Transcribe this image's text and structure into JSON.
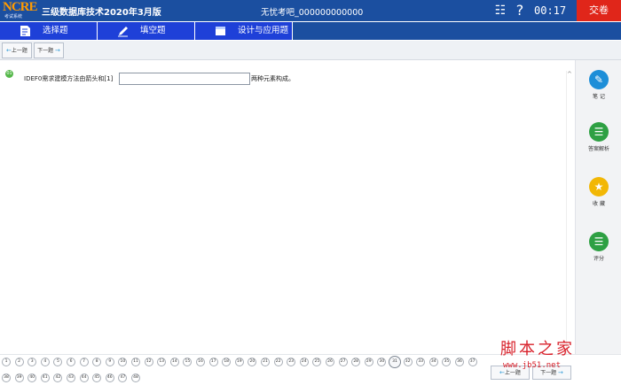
{
  "header": {
    "logo_text": "NCRE",
    "logo_sub": "考试系统",
    "title": "三级数据库技术2020年3月版",
    "examinee": "无忧考吧_000000000000",
    "timer": "00:17",
    "submit_label": "交卷",
    "list_icon": "list-check-icon",
    "help_icon": "?"
  },
  "tabs": [
    {
      "label": "选择题",
      "icon": "document-icon"
    },
    {
      "label": "填空题",
      "icon": "pencil-icon"
    },
    {
      "label": "设计与应用题",
      "icon": "window-icon"
    }
  ],
  "toolbar": {
    "prev_label": "上一题",
    "next_label": "下一题"
  },
  "question": {
    "number": "01",
    "text_before": "IDEF0需求建模方法由箭头和[1]",
    "answer_value": "",
    "text_after": "两种元素构成。"
  },
  "sidebar": {
    "note_label": "笔 记",
    "analysis_label": "答案解析",
    "favorite_label": "收 藏",
    "score_label": "评分"
  },
  "question_nav": {
    "numbers": [
      "1",
      "2",
      "3",
      "4",
      "5",
      "6",
      "7",
      "8",
      "9",
      "10",
      "11",
      "12",
      "13",
      "14",
      "15",
      "16",
      "17",
      "18",
      "19",
      "20",
      "21",
      "22",
      "23",
      "24",
      "25",
      "26",
      "27",
      "28",
      "29",
      "30",
      "31",
      "32",
      "33",
      "34",
      "35",
      "36",
      "37",
      "38",
      "39",
      "40",
      "41",
      "42",
      "43",
      "44",
      "45",
      "46",
      "47",
      "48"
    ],
    "current": "31",
    "prev_label": "上一题",
    "next_label": "下一题"
  },
  "watermark": {
    "line1": "脚本之家",
    "line2": "www.jb51.net"
  }
}
